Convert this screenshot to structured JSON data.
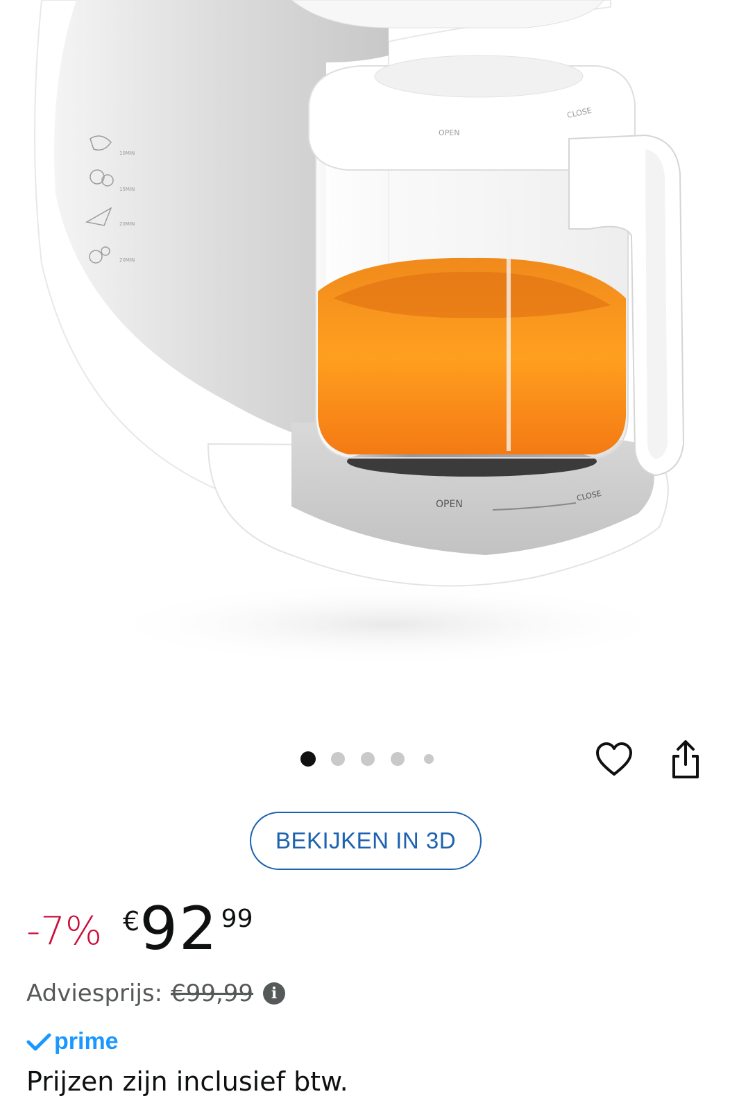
{
  "product_image": {
    "labels": {
      "open_small": "OPEN",
      "close_small": "CLOSE",
      "open_base": "OPEN",
      "close_base": "CLOSE"
    },
    "timers": [
      "10MIN",
      "15MIN",
      "20MIN",
      "20MIN"
    ]
  },
  "carousel": {
    "count": 5,
    "active_index": 0
  },
  "icons": {
    "wishlist": "heart-icon",
    "share": "share-icon"
  },
  "view_in_3d_label": "BEKIJKEN IN 3D",
  "price": {
    "discount": "-7%",
    "symbol": "€",
    "whole": "92",
    "fraction": "99"
  },
  "list_price": {
    "label": "Adviesprijs:",
    "value": "€99,99"
  },
  "prime_label": "prime",
  "vat_note": "Prijzen zijn inclusief btw.",
  "colors": {
    "link_blue": "#1c62b0",
    "discount_red": "#cc0c39",
    "prime_blue": "#1a98ff"
  }
}
